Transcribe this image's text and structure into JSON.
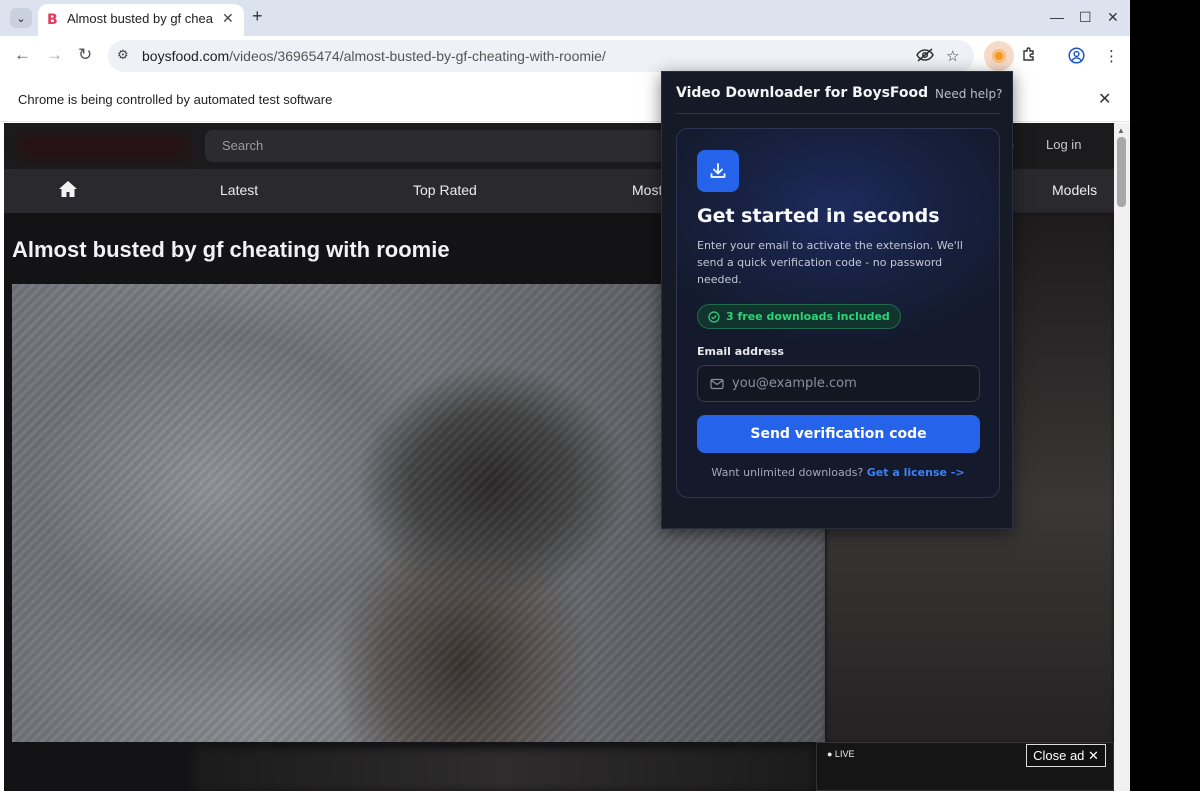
{
  "browser": {
    "tab": {
      "favicon": "B",
      "title": "Almost busted by gf chea",
      "close_glyph": "✕"
    },
    "new_tab_glyph": "+",
    "window_controls": {
      "minimize": "—",
      "maximize": "☐",
      "close": "✕"
    },
    "url": {
      "host": "boysfood.com",
      "path": "/videos/36965474/almost-busted-by-gf-cheating-with-roomie/"
    },
    "infobar": {
      "text": "Chrome is being controlled by automated test software",
      "close_glyph": "✕"
    }
  },
  "site": {
    "search_placeholder": "Search",
    "login_label": "Log in",
    "nav": {
      "latest": "Latest",
      "top_rated": "Top Rated",
      "most": "Most",
      "models": "Models"
    },
    "video_title": "Almost busted by gf cheating with roomie",
    "ad": {
      "live_label": "● LIVE",
      "close_label": "Close ad ✕"
    }
  },
  "extension_popup": {
    "title": "Video Downloader for BoysFood",
    "help_link": "Need help?",
    "heading": "Get started in seconds",
    "description": "Enter your email to activate the extension. We'll send a quick verification code - no password needed.",
    "badge": "3 free downloads included",
    "email_label": "Email address",
    "email_placeholder": "you@example.com",
    "email_value": "",
    "submit_label": "Send verification code",
    "license_prompt": "Want unlimited downloads?",
    "license_link": "Get a license ->",
    "colors": {
      "background": "#161a26",
      "accent": "#2563eb",
      "badge_text": "#2fd37a",
      "link": "#3b82f6"
    }
  }
}
